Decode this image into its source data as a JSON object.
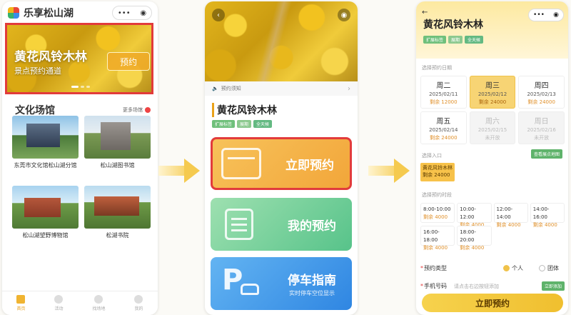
{
  "screen1": {
    "app_title": "乐享松山湖",
    "capsule_icons": [
      "more-dots-icon",
      "record-icon"
    ],
    "banner": {
      "title": "黄花风铃木林",
      "subtitle": "景点预约通道",
      "button": "预约"
    },
    "section_title": "文化场馆",
    "more_label": "更多场馆",
    "venues": [
      {
        "name": "东莞市文化馆松山湖分馆"
      },
      {
        "name": "松山湖图书馆"
      },
      {
        "name": "松山湖望野博物馆"
      },
      {
        "name": "松湖书院"
      }
    ],
    "tabs": [
      {
        "label": "首页",
        "icon": "home-icon"
      },
      {
        "label": "活动",
        "icon": "activity-icon"
      },
      {
        "label": "找场地",
        "icon": "venue-icon"
      },
      {
        "label": "我的",
        "icon": "user-icon"
      }
    ]
  },
  "screen2": {
    "notice": "预约须知",
    "title": "黄花风铃木林",
    "tags": [
      "扩展标签",
      "展期",
      "全天候"
    ],
    "buttons": [
      {
        "label": "立即预约",
        "icon": "calendar-icon"
      },
      {
        "label": "我的预约",
        "icon": "clipboard-icon"
      },
      {
        "label": "停车指南",
        "sub": "实时停车空位显示",
        "icon": "parking-icon"
      }
    ]
  },
  "screen3": {
    "title": "黄花风铃木林",
    "tags": [
      "扩展标签",
      "展期",
      "全天候"
    ],
    "date_label": "选择预约日期",
    "days": [
      {
        "name": "周二",
        "date": "2025/02/11",
        "remain": "剩余 12000",
        "state": "normal"
      },
      {
        "name": "周三",
        "date": "2025/02/12",
        "remain": "剩余 24000",
        "state": "selected"
      },
      {
        "name": "周四",
        "date": "2025/02/13",
        "remain": "剩余 24000",
        "state": "normal"
      },
      {
        "name": "周五",
        "date": "2025/02/14",
        "remain": "剩余 24000",
        "state": "normal"
      },
      {
        "name": "周六",
        "date": "2025/02/15",
        "remain": "未开放",
        "state": "disabled"
      },
      {
        "name": "周日",
        "date": "2025/02/16",
        "remain": "未开放",
        "state": "disabled"
      }
    ],
    "person_label": "选择入口",
    "person_button": "查看展点地图",
    "person_card": {
      "name": "黄花风铃木林",
      "remain": "剩余 24000"
    },
    "slot_label": "选择预约时段",
    "slots": [
      {
        "time": "8:00-10:00",
        "remain": "剩余 4000"
      },
      {
        "time": "10:00-12:00",
        "remain": "剩余 4000"
      },
      {
        "time": "12:00-14:00",
        "remain": "剩余 4000"
      },
      {
        "time": "14:00-16:00",
        "remain": "剩余 4000"
      },
      {
        "time": "16:00-18:00",
        "remain": "剩余 4000"
      },
      {
        "time": "18:00-20:00",
        "remain": "剩余 4000"
      }
    ],
    "type_label": "预约类型",
    "type_options": [
      "个人",
      "团体"
    ],
    "phone_label": "手机号码",
    "phone_placeholder": "请点击右边按钮添加",
    "phone_button": "立即添加",
    "submit": "立即预约"
  }
}
